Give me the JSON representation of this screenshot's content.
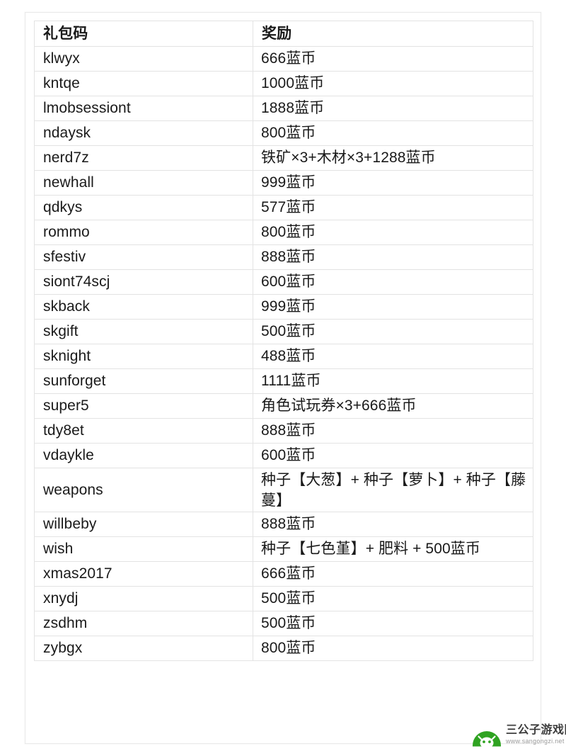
{
  "table": {
    "headers": {
      "code": "礼包码",
      "reward": "奖励"
    },
    "rows": [
      {
        "code": "klwyx",
        "reward": "666蓝币",
        "tall": false
      },
      {
        "code": "kntqe",
        "reward": "1000蓝币",
        "tall": false
      },
      {
        "code": "lmobsessiont",
        "reward": "1888蓝币",
        "tall": false
      },
      {
        "code": "ndaysk",
        "reward": "800蓝币",
        "tall": false
      },
      {
        "code": "nerd7z",
        "reward": "铁矿×3+木材×3+1288蓝币",
        "tall": false
      },
      {
        "code": "newhall",
        "reward": "999蓝币",
        "tall": false
      },
      {
        "code": "qdkys",
        "reward": "577蓝币",
        "tall": false
      },
      {
        "code": "rommo",
        "reward": "800蓝币",
        "tall": false
      },
      {
        "code": "sfestiv",
        "reward": "888蓝币",
        "tall": false
      },
      {
        "code": "siont74scj",
        "reward": "600蓝币",
        "tall": false
      },
      {
        "code": "skback",
        "reward": "999蓝币",
        "tall": false
      },
      {
        "code": "skgift",
        "reward": "500蓝币",
        "tall": false
      },
      {
        "code": "sknight",
        "reward": "488蓝币",
        "tall": false
      },
      {
        "code": "sunforget",
        "reward": "1111蓝币",
        "tall": false
      },
      {
        "code": "super5",
        "reward": "角色试玩券×3+666蓝币",
        "tall": false
      },
      {
        "code": "tdy8et",
        "reward": "888蓝币",
        "tall": false
      },
      {
        "code": "vdaykle",
        "reward": "600蓝币",
        "tall": false
      },
      {
        "code": "weapons",
        "reward": "种子【大葱】+ 种子【萝卜】+ 种子【藤蔓】",
        "tall": true
      },
      {
        "code": "willbeby",
        "reward": "888蓝币",
        "tall": false
      },
      {
        "code": "wish",
        "reward": "种子【七色堇】+ 肥料 + 500蓝币",
        "tall": false
      },
      {
        "code": "xmas2017",
        "reward": "666蓝币",
        "tall": false
      },
      {
        "code": "xnydj",
        "reward": "500蓝币",
        "tall": false
      },
      {
        "code": "zsdhm",
        "reward": "500蓝币",
        "tall": false
      },
      {
        "code": "zybgx",
        "reward": "800蓝币",
        "tall": false
      }
    ]
  },
  "watermark": {
    "site_name": "三公子游戏网",
    "url": "www.sangongzi.net",
    "logo_color": "#2fa321",
    "logo_icon": "mushroom-mascot-icon"
  },
  "colors": {
    "text": "#1a1a1a",
    "border": "#e3e3e3",
    "page_border": "#e8e8e8",
    "watermark_title": "#3d3d3d",
    "watermark_url": "#9a9a9a"
  }
}
